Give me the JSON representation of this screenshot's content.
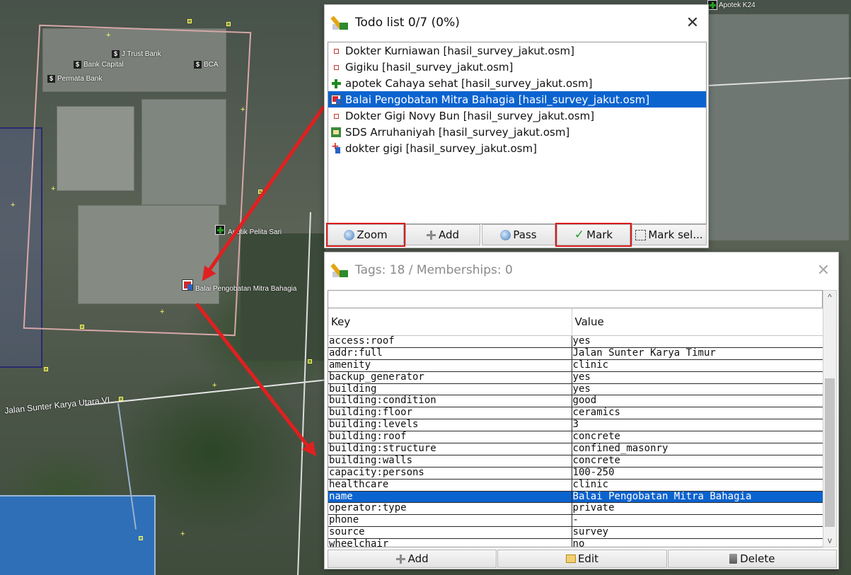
{
  "map": {
    "labels": {
      "trust_bank": "J Trust Bank",
      "bank_capital": "Bank Capital",
      "bca": "BCA",
      "permata": "Permata Bank",
      "apotik_pelita": "Apotik Pelita Sari",
      "balai": "Balai Pengobatan Mitra Bahagia",
      "apotek_k24": "Apotek K24",
      "road": "Jalan Sunter Karya Utara VI"
    },
    "bank_icon_glyph": "$",
    "arrow_color": "#e02020"
  },
  "todo": {
    "title": "Todo list 0/7 (0%)",
    "close_glyph": "✕",
    "items": [
      {
        "icon": "square-marker-icon",
        "text": "Dokter Kurniawan [hasil_survey_jakut.osm]",
        "selected": false
      },
      {
        "icon": "square-marker-icon",
        "text": "Gigiku [hasil_survey_jakut.osm]",
        "selected": false
      },
      {
        "icon": "pharmacy-cross-icon",
        "text": "apotek Cahaya sehat [hasil_survey_jakut.osm]",
        "selected": false
      },
      {
        "icon": "clinic-icon",
        "text": "Balai Pengobatan Mitra Bahagia [hasil_survey_jakut.osm]",
        "selected": true
      },
      {
        "icon": "square-marker-icon",
        "text": "Dokter Gigi Novy Bun [hasil_survey_jakut.osm]",
        "selected": false
      },
      {
        "icon": "school-icon",
        "text": "SDS Arruhaniyah [hasil_survey_jakut.osm]",
        "selected": false
      },
      {
        "icon": "dentist-icon",
        "text": "dokter gigi [hasil_survey_jakut.osm]",
        "selected": false
      }
    ],
    "buttons": {
      "zoom": "Zoom",
      "add": "Add",
      "pass": "Pass",
      "mark": "Mark",
      "mark_selected": "Mark sel..."
    },
    "highlight_color": "#d91c1c"
  },
  "tags": {
    "title": "Tags: 18 / Memberships: 0",
    "close_glyph": "✕",
    "header": {
      "key": "Key",
      "value": "Value"
    },
    "rows": [
      {
        "key": "access:roof",
        "value": "yes",
        "selected": false
      },
      {
        "key": "addr:full",
        "value": "Jalan Sunter Karya Timur",
        "selected": false
      },
      {
        "key": "amenity",
        "value": "clinic",
        "selected": false
      },
      {
        "key": "backup_generator",
        "value": "yes",
        "selected": false
      },
      {
        "key": "building",
        "value": "yes",
        "selected": false
      },
      {
        "key": "building:condition",
        "value": "good",
        "selected": false
      },
      {
        "key": "building:floor",
        "value": "ceramics",
        "selected": false
      },
      {
        "key": "building:levels",
        "value": "3",
        "selected": false
      },
      {
        "key": "building:roof",
        "value": "concrete",
        "selected": false
      },
      {
        "key": "building:structure",
        "value": "confined_masonry",
        "selected": false
      },
      {
        "key": "building:walls",
        "value": "concrete",
        "selected": false
      },
      {
        "key": "capacity:persons",
        "value": "100-250",
        "selected": false
      },
      {
        "key": "healthcare",
        "value": "clinic",
        "selected": false
      },
      {
        "key": "name",
        "value": "Balai Pengobatan Mitra Bahagia",
        "selected": true
      },
      {
        "key": "operator:type",
        "value": "private",
        "selected": false
      },
      {
        "key": "phone",
        "value": "-",
        "selected": false
      },
      {
        "key": "source",
        "value": "survey",
        "selected": false
      },
      {
        "key": "wheelchair",
        "value": "no",
        "selected": false
      }
    ],
    "buttons": {
      "add": "Add",
      "edit": "Edit",
      "delete": "Delete"
    },
    "scroll": {
      "up_glyph": "^",
      "down_glyph": "v"
    },
    "selection_color": "#0b63cf"
  }
}
